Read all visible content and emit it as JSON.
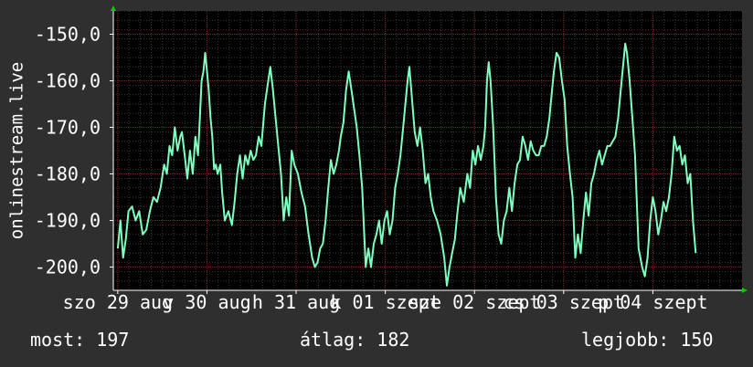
{
  "chart_data": {
    "type": "line",
    "ylabel": "onlinestream.live",
    "ylim": [
      -205,
      -145
    ],
    "yticks": [
      -150,
      -160,
      -170,
      -180,
      -190,
      -200
    ],
    "ytick_labels": [
      "-150,0",
      "-160,0",
      "-170,0",
      "-180,0",
      "-190,0",
      "-200,0"
    ],
    "xlim": [
      -0.05,
      7.0
    ],
    "xticks": [
      0,
      1,
      2,
      3,
      4,
      5,
      6
    ],
    "xtick_labels": [
      "szo 29 aug",
      "v 30 aug",
      "h 31 aug",
      "k 01 szept",
      "sze 02 szept",
      "cs 03 szept",
      "p 04 szept"
    ],
    "grid": true,
    "line_color": "#7fffbf",
    "series": [
      {
        "values": [
          [
            0.0,
            -196
          ],
          [
            0.03,
            -190
          ],
          [
            0.06,
            -198
          ],
          [
            0.09,
            -194
          ],
          [
            0.12,
            -188
          ],
          [
            0.16,
            -187
          ],
          [
            0.2,
            -190
          ],
          [
            0.24,
            -188
          ],
          [
            0.28,
            -193
          ],
          [
            0.32,
            -192
          ],
          [
            0.36,
            -188
          ],
          [
            0.4,
            -185
          ],
          [
            0.44,
            -186
          ],
          [
            0.48,
            -183
          ],
          [
            0.52,
            -178
          ],
          [
            0.55,
            -180
          ],
          [
            0.58,
            -174
          ],
          [
            0.61,
            -176
          ],
          [
            0.64,
            -170
          ],
          [
            0.67,
            -175
          ],
          [
            0.7,
            -172
          ],
          [
            0.72,
            -171
          ],
          [
            0.75,
            -176
          ],
          [
            0.78,
            -181
          ],
          [
            0.81,
            -175
          ],
          [
            0.84,
            -180
          ],
          [
            0.87,
            -172
          ],
          [
            0.9,
            -176
          ],
          [
            0.92,
            -168
          ],
          [
            0.94,
            -160
          ],
          [
            0.96,
            -158
          ],
          [
            0.98,
            -154
          ],
          [
            1.0,
            -158
          ],
          [
            1.02,
            -162
          ],
          [
            1.04,
            -168
          ],
          [
            1.06,
            -172
          ],
          [
            1.08,
            -179
          ],
          [
            1.1,
            -178
          ],
          [
            1.12,
            -180
          ],
          [
            1.15,
            -178
          ],
          [
            1.17,
            -184
          ],
          [
            1.2,
            -190
          ],
          [
            1.24,
            -188
          ],
          [
            1.28,
            -191
          ],
          [
            1.31,
            -186
          ],
          [
            1.34,
            -180
          ],
          [
            1.37,
            -176
          ],
          [
            1.4,
            -181
          ],
          [
            1.43,
            -176
          ],
          [
            1.46,
            -178
          ],
          [
            1.49,
            -175
          ],
          [
            1.52,
            -177
          ],
          [
            1.55,
            -176
          ],
          [
            1.58,
            -172
          ],
          [
            1.61,
            -174
          ],
          [
            1.65,
            -165
          ],
          [
            1.68,
            -161
          ],
          [
            1.71,
            -157
          ],
          [
            1.74,
            -162
          ],
          [
            1.77,
            -168
          ],
          [
            1.8,
            -174
          ],
          [
            1.83,
            -180
          ],
          [
            1.86,
            -190
          ],
          [
            1.89,
            -185
          ],
          [
            1.92,
            -189
          ],
          [
            1.95,
            -175
          ],
          [
            1.98,
            -178
          ],
          [
            2.02,
            -180
          ],
          [
            2.06,
            -184
          ],
          [
            2.1,
            -187
          ],
          [
            2.14,
            -193
          ],
          [
            2.18,
            -198
          ],
          [
            2.21,
            -200
          ],
          [
            2.24,
            -199
          ],
          [
            2.27,
            -196
          ],
          [
            2.3,
            -195
          ],
          [
            2.33,
            -190
          ],
          [
            2.36,
            -183
          ],
          [
            2.39,
            -177
          ],
          [
            2.42,
            -180
          ],
          [
            2.45,
            -178
          ],
          [
            2.48,
            -175
          ],
          [
            2.5,
            -172
          ],
          [
            2.53,
            -169
          ],
          [
            2.56,
            -162
          ],
          [
            2.59,
            -158
          ],
          [
            2.62,
            -162
          ],
          [
            2.65,
            -166
          ],
          [
            2.68,
            -170
          ],
          [
            2.71,
            -176
          ],
          [
            2.74,
            -183
          ],
          [
            2.78,
            -200
          ],
          [
            2.81,
            -196
          ],
          [
            2.84,
            -200
          ],
          [
            2.87,
            -195
          ],
          [
            2.9,
            -193
          ],
          [
            2.93,
            -190
          ],
          [
            2.96,
            -195
          ],
          [
            2.99,
            -190
          ],
          [
            3.02,
            -188
          ],
          [
            3.05,
            -193
          ],
          [
            3.08,
            -190
          ],
          [
            3.11,
            -183
          ],
          [
            3.14,
            -180
          ],
          [
            3.17,
            -176
          ],
          [
            3.2,
            -170
          ],
          [
            3.22,
            -166
          ],
          [
            3.25,
            -160
          ],
          [
            3.27,
            -157
          ],
          [
            3.3,
            -164
          ],
          [
            3.33,
            -171
          ],
          [
            3.36,
            -174
          ],
          [
            3.39,
            -170
          ],
          [
            3.42,
            -175
          ],
          [
            3.45,
            -182
          ],
          [
            3.48,
            -180
          ],
          [
            3.51,
            -185
          ],
          [
            3.54,
            -188
          ],
          [
            3.58,
            -190
          ],
          [
            3.62,
            -193
          ],
          [
            3.66,
            -198
          ],
          [
            3.69,
            -204
          ],
          [
            3.72,
            -200
          ],
          [
            3.75,
            -197
          ],
          [
            3.78,
            -194
          ],
          [
            3.81,
            -188
          ],
          [
            3.84,
            -183
          ],
          [
            3.88,
            -186
          ],
          [
            3.92,
            -180
          ],
          [
            3.95,
            -183
          ],
          [
            3.98,
            -175
          ],
          [
            4.01,
            -178
          ],
          [
            4.04,
            -174
          ],
          [
            4.07,
            -177
          ],
          [
            4.1,
            -174
          ],
          [
            4.12,
            -170
          ],
          [
            4.14,
            -160
          ],
          [
            4.16,
            -156
          ],
          [
            4.18,
            -160
          ],
          [
            4.21,
            -170
          ],
          [
            4.24,
            -185
          ],
          [
            4.27,
            -193
          ],
          [
            4.3,
            -195
          ],
          [
            4.33,
            -190
          ],
          [
            4.36,
            -188
          ],
          [
            4.39,
            -183
          ],
          [
            4.42,
            -188
          ],
          [
            4.45,
            -182
          ],
          [
            4.48,
            -178
          ],
          [
            4.51,
            -177
          ],
          [
            4.54,
            -172
          ],
          [
            4.57,
            -174
          ],
          [
            4.6,
            -177
          ],
          [
            4.63,
            -173
          ],
          [
            4.66,
            -175
          ],
          [
            4.69,
            -176
          ],
          [
            4.72,
            -176
          ],
          [
            4.75,
            -174
          ],
          [
            4.78,
            -174
          ],
          [
            4.81,
            -172
          ],
          [
            4.84,
            -168
          ],
          [
            4.87,
            -162
          ],
          [
            4.89,
            -158
          ],
          [
            4.92,
            -154
          ],
          [
            4.95,
            -155
          ],
          [
            4.98,
            -160
          ],
          [
            5.01,
            -164
          ],
          [
            5.04,
            -174
          ],
          [
            5.07,
            -180
          ],
          [
            5.1,
            -185
          ],
          [
            5.13,
            -198
          ],
          [
            5.16,
            -193
          ],
          [
            5.19,
            -197
          ],
          [
            5.22,
            -190
          ],
          [
            5.25,
            -184
          ],
          [
            5.28,
            -189
          ],
          [
            5.31,
            -182
          ],
          [
            5.34,
            -180
          ],
          [
            5.37,
            -177
          ],
          [
            5.4,
            -175
          ],
          [
            5.43,
            -178
          ],
          [
            5.46,
            -176
          ],
          [
            5.49,
            -174
          ],
          [
            5.52,
            -174
          ],
          [
            5.55,
            -173
          ],
          [
            5.58,
            -172
          ],
          [
            5.61,
            -168
          ],
          [
            5.64,
            -162
          ],
          [
            5.67,
            -156
          ],
          [
            5.69,
            -152
          ],
          [
            5.71,
            -154
          ],
          [
            5.74,
            -160
          ],
          [
            5.77,
            -168
          ],
          [
            5.8,
            -176
          ],
          [
            5.84,
            -196
          ],
          [
            5.88,
            -200
          ],
          [
            5.91,
            -202
          ],
          [
            5.94,
            -198
          ],
          [
            5.97,
            -190
          ],
          [
            6.0,
            -185
          ],
          [
            6.03,
            -188
          ],
          [
            6.06,
            -193
          ],
          [
            6.09,
            -190
          ],
          [
            6.12,
            -186
          ],
          [
            6.15,
            -188
          ],
          [
            6.18,
            -185
          ],
          [
            6.21,
            -180
          ],
          [
            6.24,
            -172
          ],
          [
            6.27,
            -175
          ],
          [
            6.3,
            -174
          ],
          [
            6.33,
            -178
          ],
          [
            6.36,
            -176
          ],
          [
            6.39,
            -182
          ],
          [
            6.42,
            -180
          ],
          [
            6.45,
            -190
          ],
          [
            6.48,
            -197
          ]
        ]
      }
    ],
    "stats": {
      "now_label": "most:",
      "now_value": "197",
      "avg_label": "átlag:",
      "avg_value": "182",
      "best_label": "legjobb:",
      "best_value": "150"
    }
  }
}
